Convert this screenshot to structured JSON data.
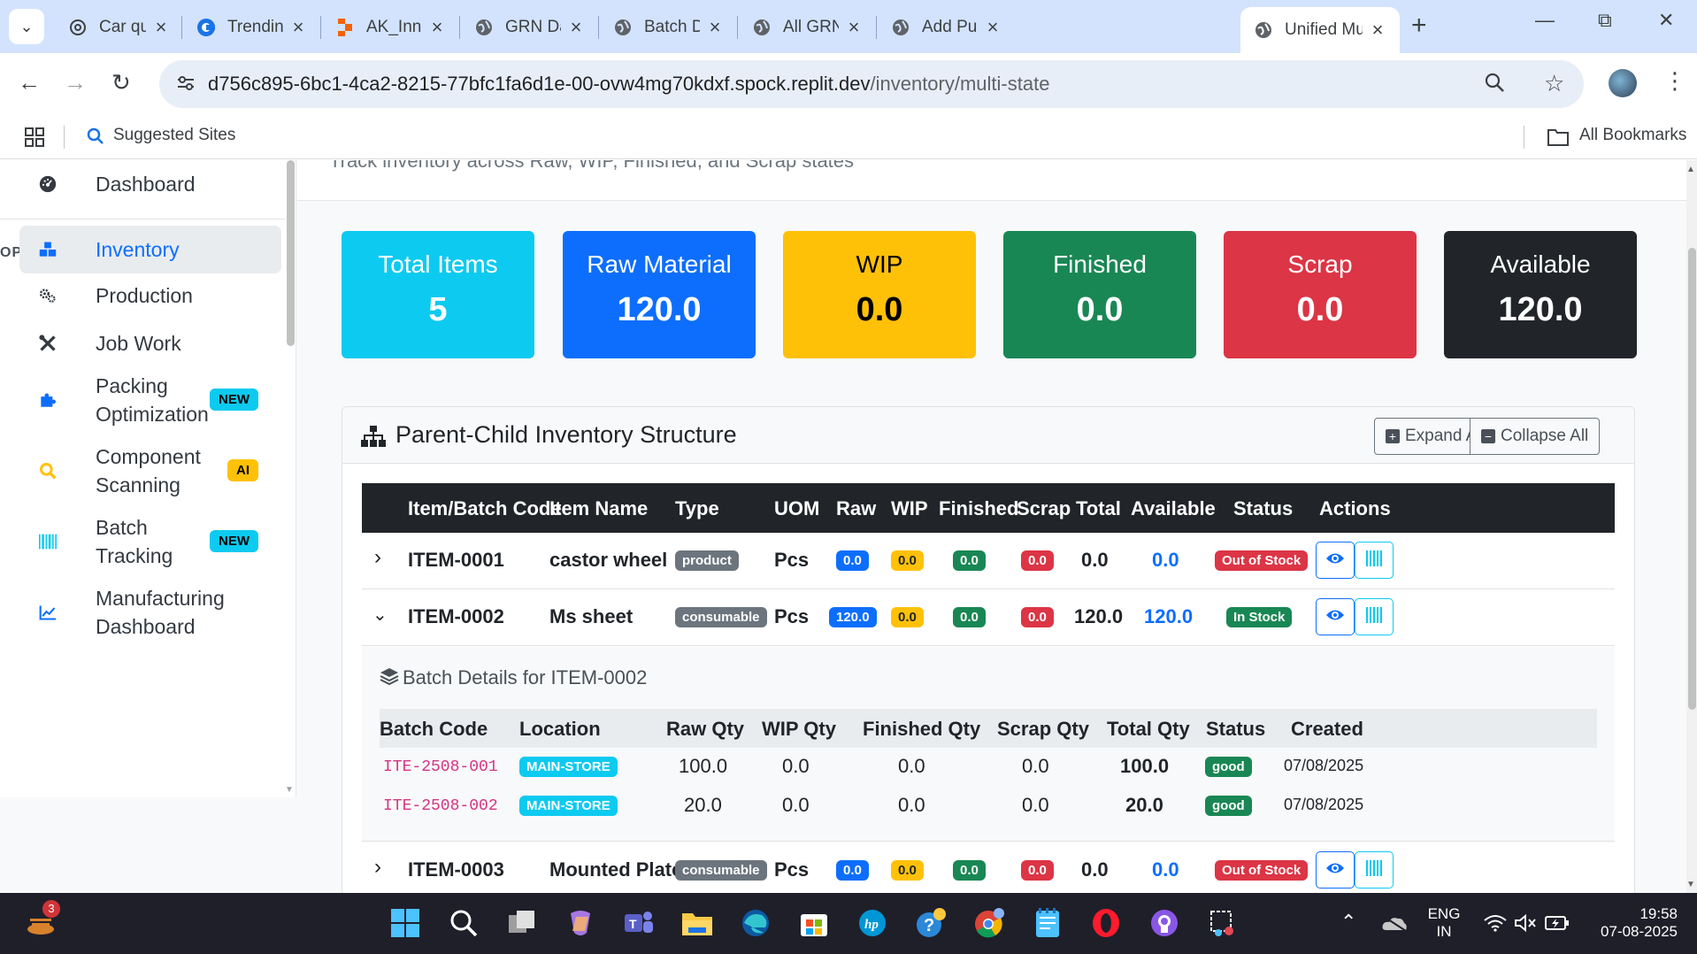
{
  "browser": {
    "tabs": [
      {
        "title": "Car quotat",
        "icon": "openai-icon"
      },
      {
        "title": "Trending C",
        "icon": "c-logo-icon"
      },
      {
        "title": "AK_Innova",
        "icon": "replit-icon"
      },
      {
        "title": "GRN Dashb",
        "icon": "globe-icon"
      },
      {
        "title": "Batch Deta",
        "icon": "globe-icon"
      },
      {
        "title": "All GRNs",
        "icon": "globe-icon"
      },
      {
        "title": "Add Purch",
        "icon": "globe-icon"
      },
      {
        "title": "Unified Mu",
        "icon": "globe-icon",
        "active": true
      }
    ],
    "url_host": "d756c895-6bc1-4ca2-8215-77bfc1fa6d1e-00-ovw4mg70kdxf.spock.replit.dev",
    "url_path": "/inventory/multi-state",
    "bookmarks": {
      "suggested": "Suggested Sites",
      "all": "All Bookmarks"
    }
  },
  "sidebar": {
    "dashboard": "Dashboard",
    "section": "OPERATIONS",
    "items": [
      {
        "label": "Inventory",
        "icon": "boxes-icon"
      },
      {
        "label": "Production",
        "icon": "gears-icon"
      },
      {
        "label": "Job Work",
        "icon": "tools-icon"
      },
      {
        "label": "Packing Optimization",
        "label1": "Packing",
        "label2": "Optimization",
        "badge": "NEW",
        "icon": "puzzle-icon"
      },
      {
        "label": "Component Scanning",
        "label1": "Component",
        "label2": "Scanning",
        "badge": "AI",
        "icon": "search-icon"
      },
      {
        "label": "Batch Tracking",
        "label1": "Batch",
        "label2": "Tracking",
        "badge": "NEW",
        "icon": "barcode-icon"
      },
      {
        "label": "Manufacturing Dashboard",
        "label1": "Manufacturing",
        "label2": "Dashboard",
        "icon": "chart-line-icon"
      }
    ]
  },
  "page": {
    "subtitle": "Track inventory across Raw, WIP, Finished, and Scrap states"
  },
  "stats": [
    {
      "label": "Total Items",
      "value": "5",
      "color": "#0dcaf0"
    },
    {
      "label": "Raw Material",
      "value": "120.0",
      "color": "#0d6efd"
    },
    {
      "label": "WIP",
      "value": "0.0",
      "color": "#ffc107"
    },
    {
      "label": "Finished",
      "value": "0.0",
      "color": "#198754"
    },
    {
      "label": "Scrap",
      "value": "0.0",
      "color": "#dc3545"
    },
    {
      "label": "Available",
      "value": "120.0",
      "color": "#212529"
    }
  ],
  "structure": {
    "title": "Parent-Child Inventory Structure",
    "expand_all": "Expand All",
    "collapse_all": "Collapse All",
    "columns": [
      "Item/Batch Code",
      "Item Name",
      "Type",
      "UOM",
      "Raw",
      "WIP",
      "Finished",
      "Scrap",
      "Total",
      "Available",
      "Status",
      "Actions"
    ],
    "rows": [
      {
        "code": "ITEM-0001",
        "name": "castor wheel",
        "type": "product",
        "uom": "Pcs",
        "raw": "0.0",
        "wip": "0.0",
        "finished": "0.0",
        "scrap": "0.0",
        "total": "0.0",
        "available": "0.0",
        "status": "Out of Stock",
        "expanded": false
      },
      {
        "code": "ITEM-0002",
        "name": "Ms sheet",
        "type": "consumable",
        "uom": "Pcs",
        "raw": "120.0",
        "wip": "0.0",
        "finished": "0.0",
        "scrap": "0.0",
        "total": "120.0",
        "available": "120.0",
        "status": "In Stock",
        "expanded": true
      },
      {
        "code": "ITEM-0003",
        "name": "Mounted Plate",
        "type": "consumable",
        "uom": "Pcs",
        "raw": "0.0",
        "wip": "0.0",
        "finished": "0.0",
        "scrap": "0.0",
        "total": "0.0",
        "available": "0.0",
        "status": "Out of Stock",
        "expanded": false
      }
    ],
    "batch_details": {
      "title": "Batch Details for ITEM-0002",
      "columns": [
        "Batch Code",
        "Location",
        "Raw Qty",
        "WIP Qty",
        "Finished Qty",
        "Scrap Qty",
        "Total Qty",
        "Status",
        "Created"
      ],
      "rows": [
        {
          "code": "ITE-2508-001",
          "location": "MAIN-STORE",
          "raw": "100.0",
          "wip": "0.0",
          "finished": "0.0",
          "scrap": "0.0",
          "total": "100.0",
          "status": "good",
          "created": "07/08/2025"
        },
        {
          "code": "ITE-2508-002",
          "location": "MAIN-STORE",
          "raw": "20.0",
          "wip": "0.0",
          "finished": "0.0",
          "scrap": "0.0",
          "total": "20.0",
          "status": "good",
          "created": "07/08/2025"
        }
      ]
    }
  },
  "taskbar": {
    "notif_count": "3",
    "lang1": "ENG",
    "lang2": "IN",
    "time": "19:58",
    "date": "07-08-2025"
  }
}
